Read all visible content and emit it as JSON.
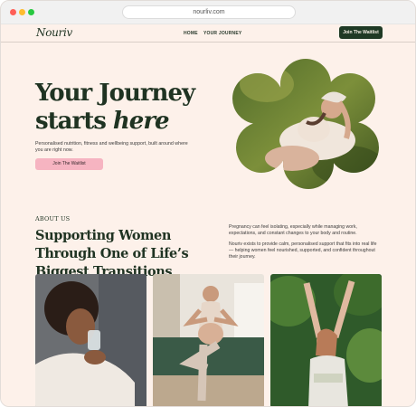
{
  "browser": {
    "url": "nourliv.com"
  },
  "nav": {
    "logo": "Nouriv",
    "links": [
      "HOME",
      "YOUR JOURNEY"
    ],
    "cta": "Join The Waitlist"
  },
  "hero": {
    "title_line1": "Your Journey",
    "title_line2_plain": "starts ",
    "title_line2_italic": "here",
    "subtitle": "Personalised nutrition, fitness and wellbeing support, built around where you are right now.",
    "cta": "Join The Waitlist"
  },
  "about": {
    "label": "ABOUT US",
    "title": "Supporting Women Through One of Life’s Biggest Transitions",
    "paragraph1": "Pregnancy can feel isolating, especially while managing work, expectations, and constant changes to your body and routine.",
    "paragraph2": "Nouriv exists to provide calm, personalised support that fits into real life — helping women feel nourished, supported, and confident throughout their journey."
  },
  "colors": {
    "background": "#fdf1ea",
    "brand_green": "#1f3a25",
    "accent_pink": "#f6b4c1"
  }
}
